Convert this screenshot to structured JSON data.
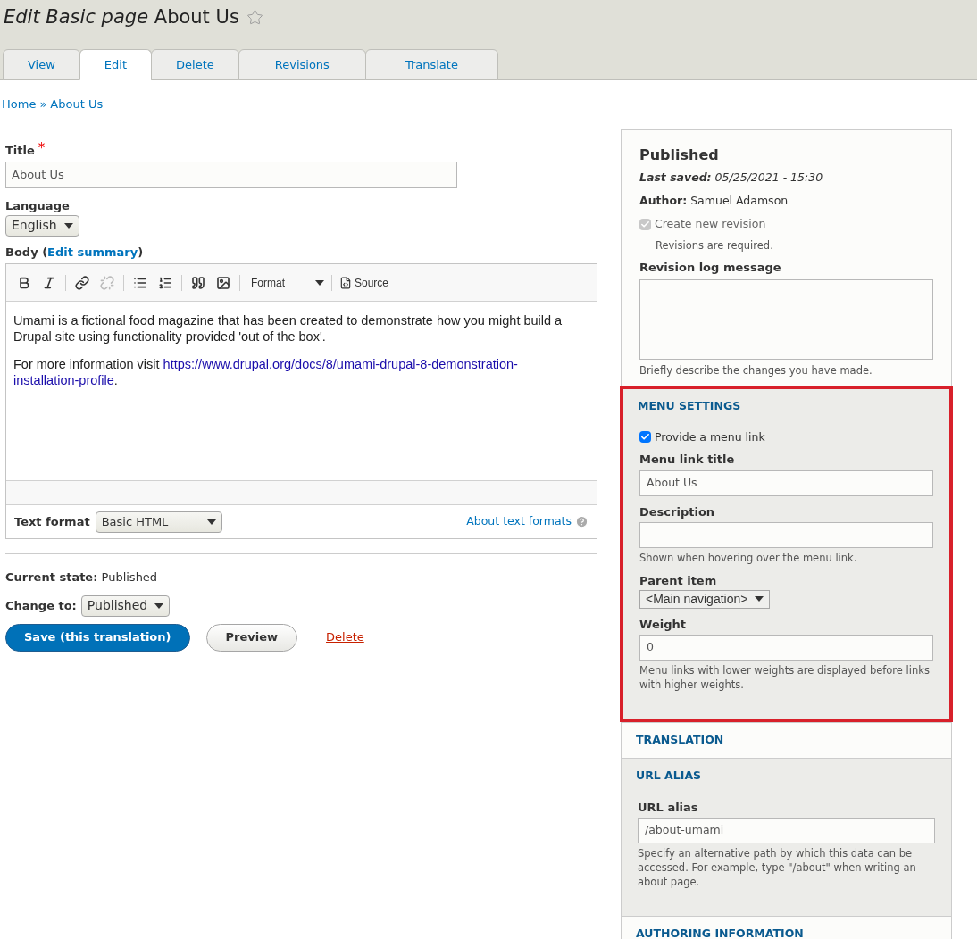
{
  "page_title": {
    "type": "Edit Basic page",
    "name": "About Us",
    "starred": false
  },
  "tabs": [
    {
      "label": "View",
      "selected": false
    },
    {
      "label": "Edit",
      "selected": true
    },
    {
      "label": "Delete",
      "selected": false
    },
    {
      "label": "Revisions",
      "selected": false
    },
    {
      "label": "Translate",
      "selected": false
    }
  ],
  "breadcrumb": [
    {
      "label": "Home"
    },
    {
      "label": "About Us"
    }
  ],
  "breadcrumb_separator": "»",
  "title_field": {
    "label": "Title",
    "required_mark": "*",
    "value": "About Us"
  },
  "language": {
    "label": "Language",
    "value": "English"
  },
  "body": {
    "label": "Body (",
    "summary_link": "Edit summary",
    "summary_close": ")",
    "toolbar": {
      "buttons": [
        {
          "disabled": false
        },
        {
          "disabled": false
        },
        {
          "disabled": false
        },
        {
          "disabled": true
        },
        {
          "disabled": false
        },
        {
          "disabled": false
        },
        {
          "disabled": false
        },
        {
          "disabled": false
        }
      ],
      "format": "Format",
      "source": "Source"
    },
    "paragraphs": [
      {
        "text": "Umami is a fictional food magazine that has been created to demonstrate how you might build a Drupal site using functionality provided 'out of the box'."
      },
      {
        "text": "For more information visit ",
        "link_lines": [
          "https://www.drupal.org/docs/8/umami-drupal-8-demonstration-",
          "installation-profile"
        ],
        "after": "."
      }
    ],
    "text_format_label": "Text format",
    "text_format": "Basic HTML",
    "about_formats": "About text formats"
  },
  "current_state": {
    "label": "Current state:",
    "value": "Published"
  },
  "change_to": {
    "label": "Change to:",
    "value": "Published"
  },
  "actions": {
    "save": "Save (this translation)",
    "preview": "Preview",
    "delete": "Delete"
  },
  "sidebar": {
    "status": "Published",
    "last_saved_label": "Last saved:",
    "last_saved": "05/25/2021 - 15:30",
    "author_label": "Author:",
    "author": "Samuel Adamson",
    "new_revision": {
      "label": "Create new revision",
      "checked": true,
      "disabled": true,
      "note": "Revisions are required."
    },
    "log": {
      "label": "Revision log message",
      "help": "Briefly describe the changes you have made."
    },
    "sections": [
      {
        "title": "MENU SETTINGS",
        "expanded": true,
        "highlighted": true,
        "fields": [
          {
            "kind": "checkbox",
            "label": "Provide a menu link",
            "checked": true
          },
          {
            "kind": "text",
            "label": "Menu link title",
            "value": "About Us"
          },
          {
            "kind": "text",
            "label": "Description",
            "help": "Shown when hovering over the menu link."
          },
          {
            "kind": "select",
            "label": "Parent item",
            "value": "<Main navigation>"
          },
          {
            "kind": "text",
            "label": "Weight",
            "value": "0",
            "help": "Menu links with lower weights are displayed before links with higher weights."
          }
        ]
      },
      {
        "title": "TRANSLATION",
        "expanded": false,
        "highlighted": false
      },
      {
        "title": "URL ALIAS",
        "expanded": true,
        "highlighted": false,
        "fields": [
          {
            "kind": "text",
            "label": "URL alias",
            "value": "/about-umami",
            "help": "Specify an alternative path by which this data can be accessed. For example, type \"/about\" when writing an about page."
          }
        ]
      },
      {
        "title": "AUTHORING INFORMATION",
        "expanded": false,
        "highlighted": false
      }
    ]
  }
}
